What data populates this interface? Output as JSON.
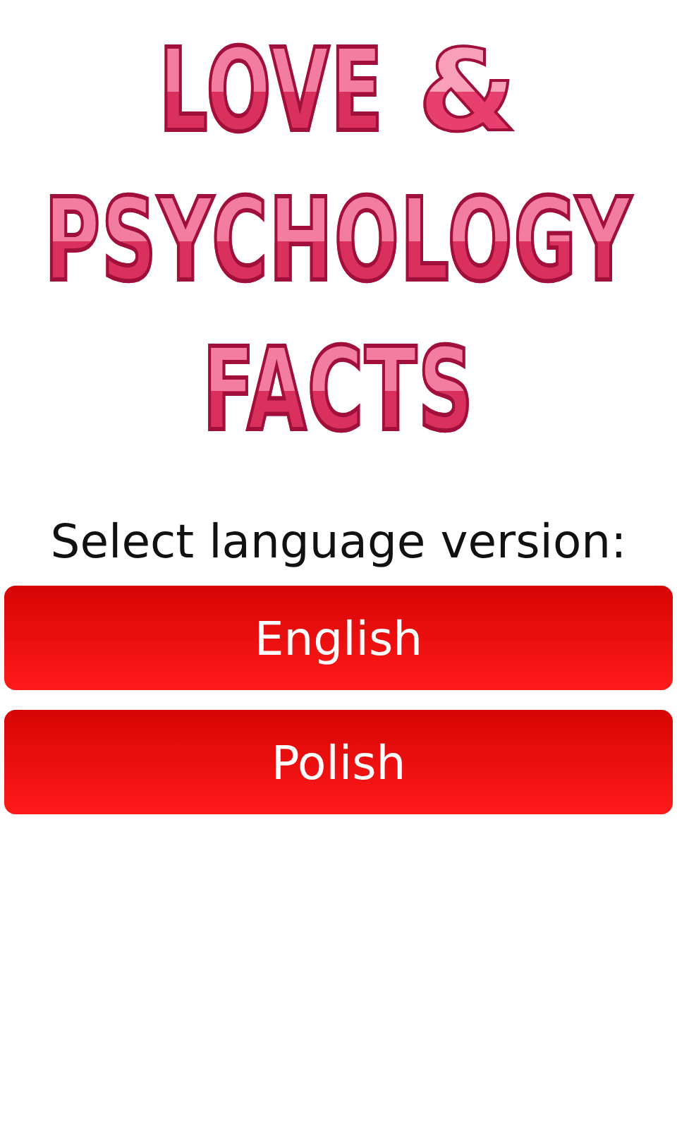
{
  "logo": {
    "lines": [
      [
        "LOVE",
        "&"
      ],
      [
        "PSYCHOLOGY"
      ],
      [
        "FACTS"
      ]
    ]
  },
  "prompt": "Select language version:",
  "buttons": [
    "English",
    "Polish"
  ]
}
